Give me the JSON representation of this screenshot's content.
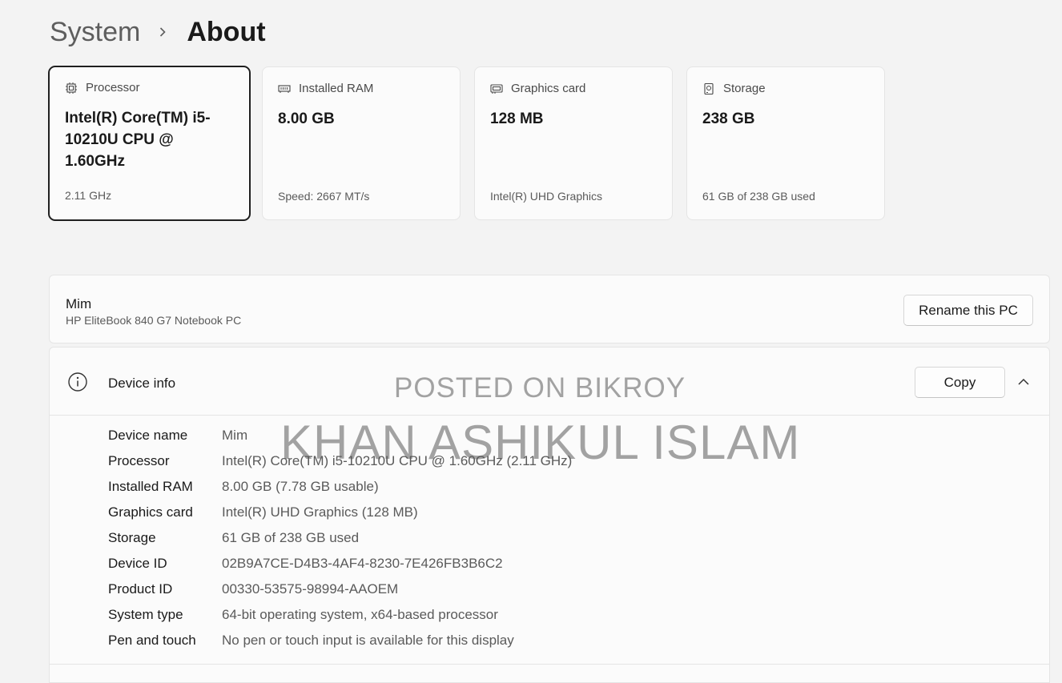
{
  "breadcrumb": {
    "parent": "System",
    "current": "About"
  },
  "cards": [
    {
      "title": "Processor",
      "icon": "processor-icon",
      "value": "Intel(R) Core(TM) i5-10210U CPU @ 1.60GHz",
      "sub": "2.11 GHz",
      "selected": true
    },
    {
      "title": "Installed RAM",
      "icon": "ram-icon",
      "value": "8.00 GB",
      "sub": "Speed: 2667 MT/s"
    },
    {
      "title": "Graphics card",
      "icon": "graphics-card-icon",
      "value": "128 MB",
      "sub": "Intel(R) UHD Graphics"
    },
    {
      "title": "Storage",
      "icon": "storage-icon",
      "value": "238 GB",
      "sub": "61 GB of 238 GB used"
    }
  ],
  "pc": {
    "name": "Mim",
    "model": "HP EliteBook 840 G7 Notebook PC",
    "rename_label": "Rename this PC"
  },
  "device_info": {
    "title": "Device info",
    "copy_label": "Copy",
    "rows": [
      {
        "label": "Device name",
        "value": "Mim"
      },
      {
        "label": "Processor",
        "value": "Intel(R) Core(TM) i5-10210U CPU @ 1.60GHz (2.11 GHz)"
      },
      {
        "label": "Installed RAM",
        "value": "8.00 GB (7.78 GB usable)"
      },
      {
        "label": "Graphics card",
        "value": "Intel(R) UHD Graphics (128 MB)"
      },
      {
        "label": "Storage",
        "value": "61 GB of 238 GB used"
      },
      {
        "label": "Device ID",
        "value": "02B9A7CE-D4B3-4AF4-8230-7E426FB3B6C2"
      },
      {
        "label": "Product ID",
        "value": "00330-53575-98994-AAOEM"
      },
      {
        "label": "System type",
        "value": "64-bit operating system, x64-based processor"
      },
      {
        "label": "Pen and touch",
        "value": "No pen or touch input is available for this display"
      }
    ]
  },
  "watermark": {
    "line1": "POSTED ON BIKROY",
    "line2": "KHAN ASHIKUL ISLAM"
  },
  "colors": {
    "background": "#f3f3f3",
    "panel": "#fbfbfb",
    "border": "#e5e5e5",
    "selected_border": "#1f1f1f"
  }
}
